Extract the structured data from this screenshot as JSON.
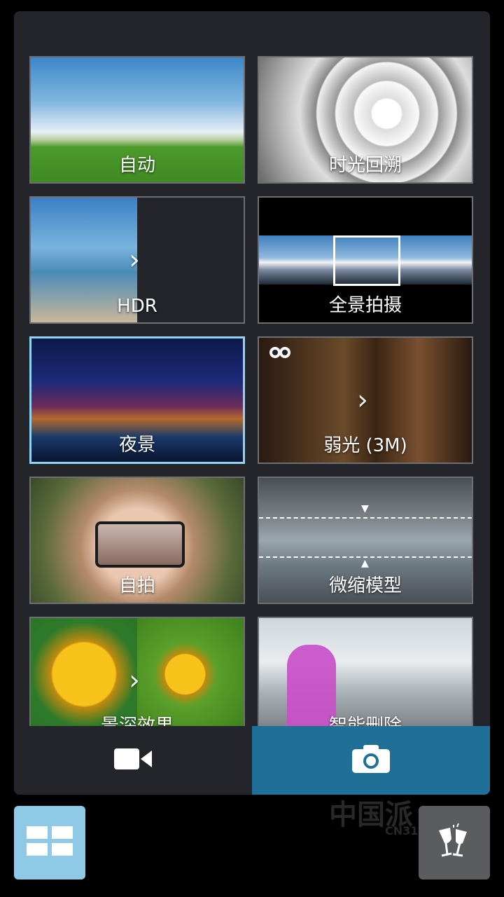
{
  "modes": [
    {
      "label": "自动"
    },
    {
      "label": "时光回溯"
    },
    {
      "label": "HDR"
    },
    {
      "label": "全景拍摄"
    },
    {
      "label": "夜景",
      "selected": true
    },
    {
      "label": "弱光 (3M)",
      "icon": "owl-icon"
    },
    {
      "label": "自拍"
    },
    {
      "label": "微缩模型"
    },
    {
      "label": "景深效果"
    },
    {
      "label": "智能删除"
    }
  ],
  "tabs": {
    "video": {
      "icon": "video-camera-icon"
    },
    "photo": {
      "icon": "camera-icon",
      "active": true
    }
  },
  "bottom_buttons": {
    "grid": {
      "icon": "grid-icon"
    },
    "party": {
      "icon": "cheers-icon"
    }
  },
  "watermark": {
    "text": "中国派",
    "sub": "CN314.C"
  },
  "colors": {
    "panel": "#23252b",
    "accent": "#1f6f96",
    "selected_border": "#8fd3f5",
    "grid_button": "#8ec9e6"
  }
}
